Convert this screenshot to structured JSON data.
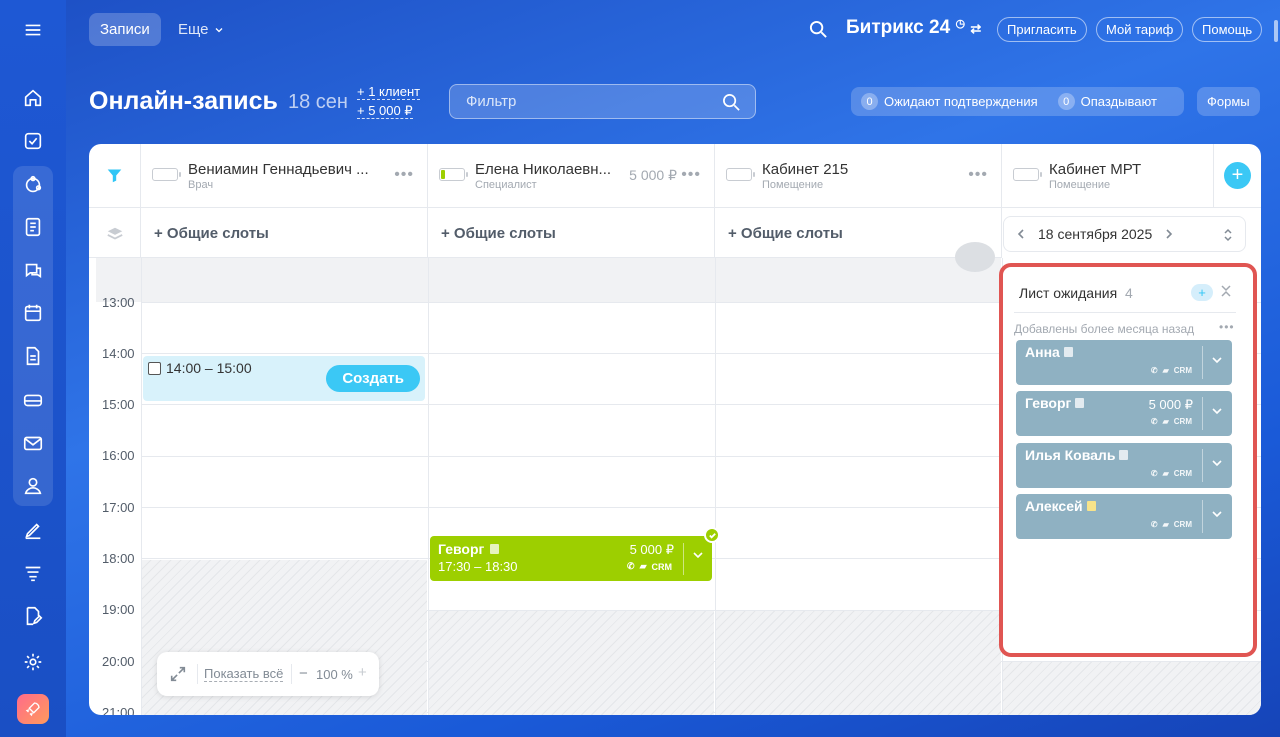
{
  "topbar": {
    "tab_active": "Записи",
    "tab_more": "Еще",
    "brand": "Битрикс 24",
    "invite": "Пригласить",
    "tariff": "Мой тариф",
    "help": "Помощь"
  },
  "header": {
    "title": "Онлайн-запись",
    "date": "18 сен",
    "stat_clients": "+ 1 клиент",
    "stat_money": "+ 5 000 ₽",
    "filter_placeholder": "Фильтр",
    "awaiting_count": "0",
    "awaiting_label": "Ожидают подтверждения",
    "late_count": "0",
    "late_label": "Опаздывают",
    "forms": "Формы"
  },
  "resources": [
    {
      "name": "Вениамин Геннадьевич ...",
      "type": "Врач",
      "price": ""
    },
    {
      "name": "Елена Николаевн...",
      "type": "Специалист",
      "price": "5 000 ₽"
    },
    {
      "name": "Кабинет 215",
      "type": "Помещение",
      "price": ""
    },
    {
      "name": "Кабинет МРТ",
      "type": "Помещение",
      "price": ""
    }
  ],
  "slots_label": "+ Общие слоты",
  "times": [
    "13:00",
    "14:00",
    "15:00",
    "16:00",
    "17:00",
    "18:00",
    "19:00",
    "20:00",
    "21:00"
  ],
  "selection": {
    "time": "14:00 – 15:00",
    "create": "Создать"
  },
  "booking": {
    "name": "Геворг",
    "time": "17:30 – 18:30",
    "price": "5 000 ₽",
    "crm": "CRM"
  },
  "zoom": {
    "show_all": "Показать всё",
    "minus": "−",
    "percent": "100 %",
    "plus": "+"
  },
  "date_picker": {
    "date": "18 сентября 2025"
  },
  "waitlist": {
    "title": "Лист ожидания",
    "count": "4",
    "section": "Добавлены более месяца назад",
    "items": [
      {
        "name": "Анна",
        "price": "",
        "crm": "CRM"
      },
      {
        "name": "Геворг",
        "price": "5 000 ₽",
        "crm": "CRM"
      },
      {
        "name": "Илья Коваль",
        "price": "",
        "crm": "CRM"
      },
      {
        "name": "Алексей",
        "price": "",
        "crm": "CRM"
      }
    ]
  },
  "colors": {
    "accent": "#3bc8f5",
    "booking_green": "#9dcf00",
    "waitlist_card": "#8fb1c2",
    "highlight_red": "#e05552"
  }
}
